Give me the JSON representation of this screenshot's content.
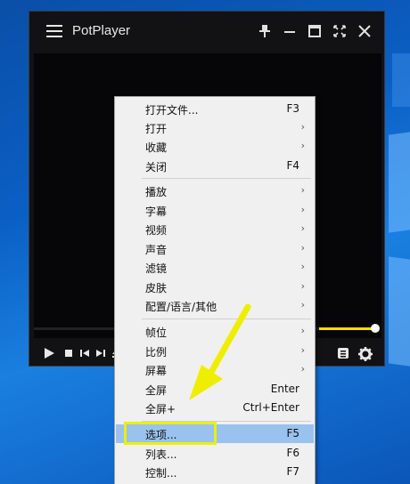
{
  "window": {
    "title": "PotPlayer"
  },
  "icons": {
    "menu": "hamburger-icon",
    "pin": "pin-icon",
    "minimize": "minimize-icon",
    "maximize": "maximize-icon",
    "fullscreen": "fullscreen-icon",
    "close": "close-icon",
    "play": "play-icon",
    "stop": "stop-icon",
    "prev": "previous-icon",
    "next": "next-icon",
    "eject": "eject-icon",
    "playlist": "playlist-icon",
    "settings": "gear-icon"
  },
  "colors": {
    "seek_fill": "#f4e000",
    "highlight_box": "#f0ee00",
    "menu_selected": "#99c2ee"
  },
  "context_menu": {
    "items": [
      {
        "label": "打开文件...",
        "shortcut": "F3"
      },
      {
        "label": "打开",
        "submenu": true
      },
      {
        "label": "收藏",
        "submenu": true
      },
      {
        "label": "关闭",
        "shortcut": "F4"
      },
      {
        "label": "播放",
        "submenu": true
      },
      {
        "label": "字幕",
        "submenu": true
      },
      {
        "label": "视频",
        "submenu": true
      },
      {
        "label": "声音",
        "submenu": true
      },
      {
        "label": "滤镜",
        "submenu": true
      },
      {
        "label": "皮肤",
        "submenu": true
      },
      {
        "label": "配置/语言/其他",
        "submenu": true
      },
      {
        "label": "帧位",
        "submenu": true
      },
      {
        "label": "比例",
        "submenu": true
      },
      {
        "label": "屏幕",
        "submenu": true
      },
      {
        "label": "全屏",
        "shortcut": "Enter"
      },
      {
        "label": "全屏+",
        "shortcut": "Ctrl+Enter"
      },
      {
        "label": "选项...",
        "shortcut": "F5",
        "selected": true
      },
      {
        "label": "列表...",
        "shortcut": "F6"
      },
      {
        "label": "控制...",
        "shortcut": "F7"
      }
    ],
    "arrow_glyph": "›"
  }
}
